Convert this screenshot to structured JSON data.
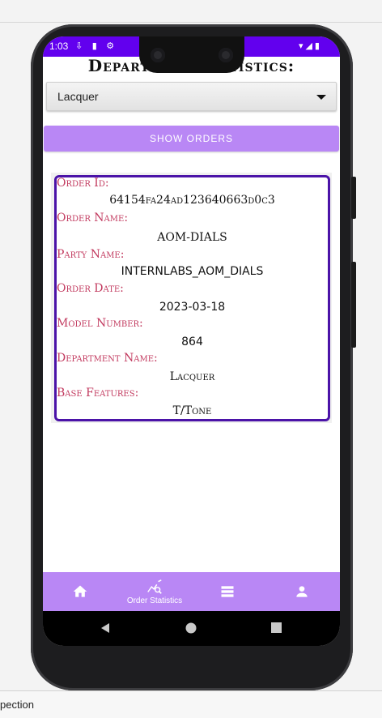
{
  "host": {
    "bottom_text": "pection"
  },
  "status_bar": {
    "time": "1:03",
    "left_icons": "⇩ ▮ ⚙",
    "right_icons": "▾◢▮"
  },
  "page": {
    "title": "Department Statistics:"
  },
  "department_select": {
    "value": "Lacquer"
  },
  "show_orders_button": {
    "label": "SHOW ORDERS"
  },
  "order": {
    "id_label": "Order Id:",
    "id_value": "64154fa24ad123640663d0c3",
    "name_label": "Order Name:",
    "name_value": "AOM-DIALS",
    "party_label": "Party Name:",
    "party_value": "INTERNLABS_AOM_DIALS",
    "date_label": "Order Date:",
    "date_value": "2023-03-18",
    "model_label": "Model Number:",
    "model_value": "864",
    "dept_label": "Department Name:",
    "dept_value": "Lacquer",
    "features_label": "Base Features:",
    "features_value": "T/Tone"
  },
  "bottom_nav": {
    "items": [
      {
        "icon": "home-icon",
        "label": ""
      },
      {
        "icon": "query-stats-icon",
        "label": "Order Statistics"
      },
      {
        "icon": "list-icon",
        "label": ""
      },
      {
        "icon": "person-icon",
        "label": ""
      }
    ]
  },
  "colors": {
    "status_bar": "#6200ee",
    "accent": "#b987f5",
    "card_border": "#4b13a8",
    "label": "#c23a5f"
  }
}
